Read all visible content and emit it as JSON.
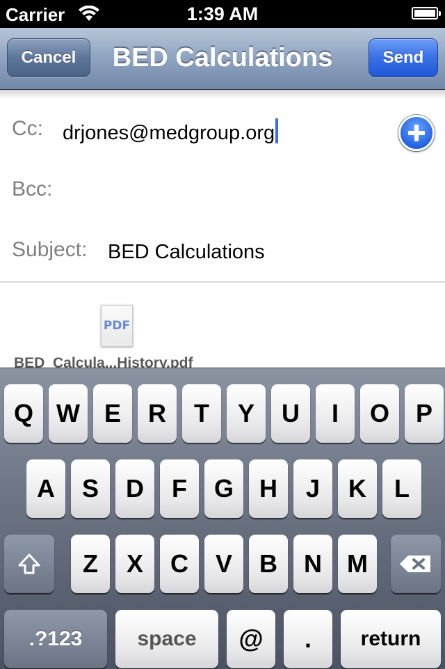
{
  "status_bar": {
    "carrier": "Carrier",
    "time": "1:39 AM"
  },
  "nav": {
    "title": "BED Calculations",
    "cancel_label": "Cancel",
    "send_label": "Send"
  },
  "form": {
    "cc_label": "Cc:",
    "cc_value": "drjones@medgroup.org",
    "bcc_label": "Bcc:",
    "bcc_value": "",
    "subject_label": "Subject:",
    "subject_value": "BED Calculations"
  },
  "attachment": {
    "icon_text": "PDF",
    "filename": "BED_Calcula...History.pdf"
  },
  "keyboard": {
    "row1": [
      "Q",
      "W",
      "E",
      "R",
      "T",
      "Y",
      "U",
      "I",
      "O",
      "P"
    ],
    "row2": [
      "A",
      "S",
      "D",
      "F",
      "G",
      "H",
      "J",
      "K",
      "L"
    ],
    "row3": [
      "Z",
      "X",
      "C",
      "V",
      "B",
      "N",
      "M"
    ],
    "numbers_label": ".?123",
    "space_label": "space",
    "at_label": "@",
    "dot_label": ".",
    "return_label": "return"
  },
  "colors": {
    "send_button": "#3870e6",
    "nav_bar": "#8ea3bf",
    "caret": "#3c6ee0"
  }
}
